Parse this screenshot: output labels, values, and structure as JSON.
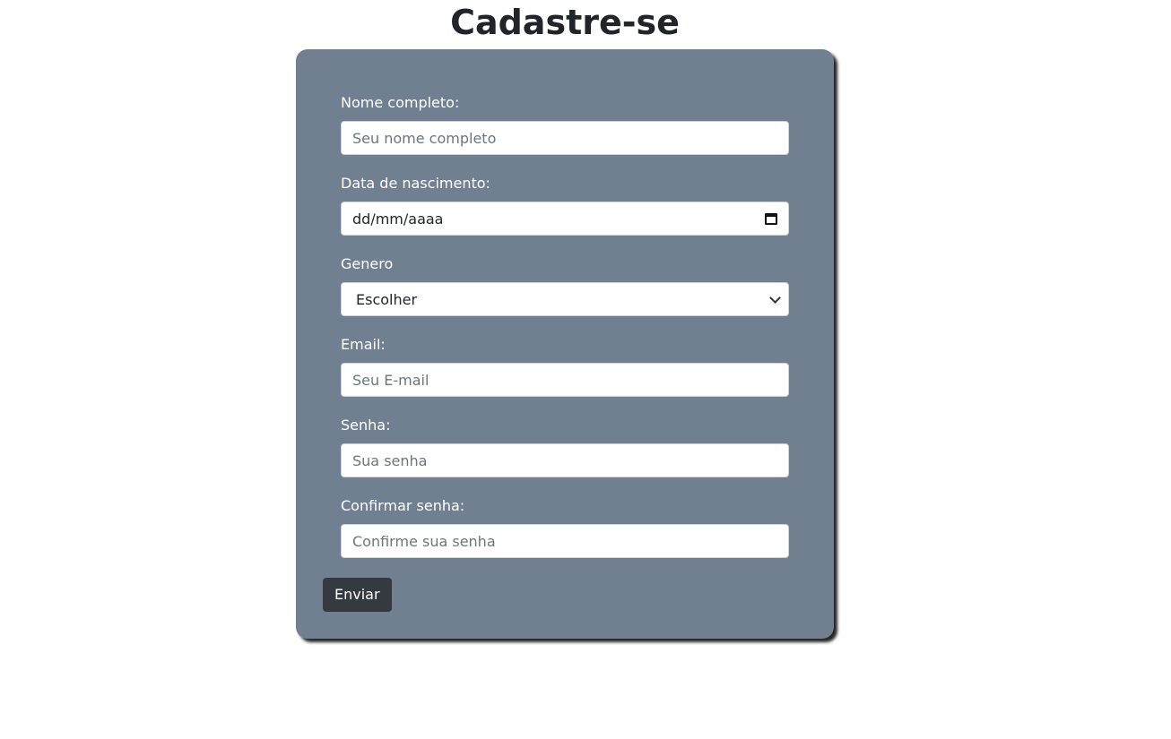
{
  "title": "Cadastre-se",
  "form": {
    "fields": [
      {
        "label": "Nome completo:",
        "placeholder": "Seu nome completo",
        "type": "text"
      },
      {
        "label": "Data de nascimento:",
        "value": "dd/mm/aaaa",
        "type": "date",
        "icon": "calendar-icon"
      },
      {
        "label": "Genero",
        "value": "Escolher",
        "type": "select",
        "icon": "chevron-down-icon"
      },
      {
        "label": "Email:",
        "placeholder": "Seu E-mail",
        "type": "email"
      },
      {
        "label": "Senha:",
        "placeholder": "Sua senha",
        "type": "password"
      },
      {
        "label": "Confirmar senha:",
        "placeholder": "Confirme sua senha",
        "type": "password"
      }
    ],
    "submit_label": "Enviar"
  },
  "colors": {
    "card_background": "#708090",
    "button_background": "#343a40",
    "title_text": "#212529",
    "label_text": "#ffffff"
  }
}
